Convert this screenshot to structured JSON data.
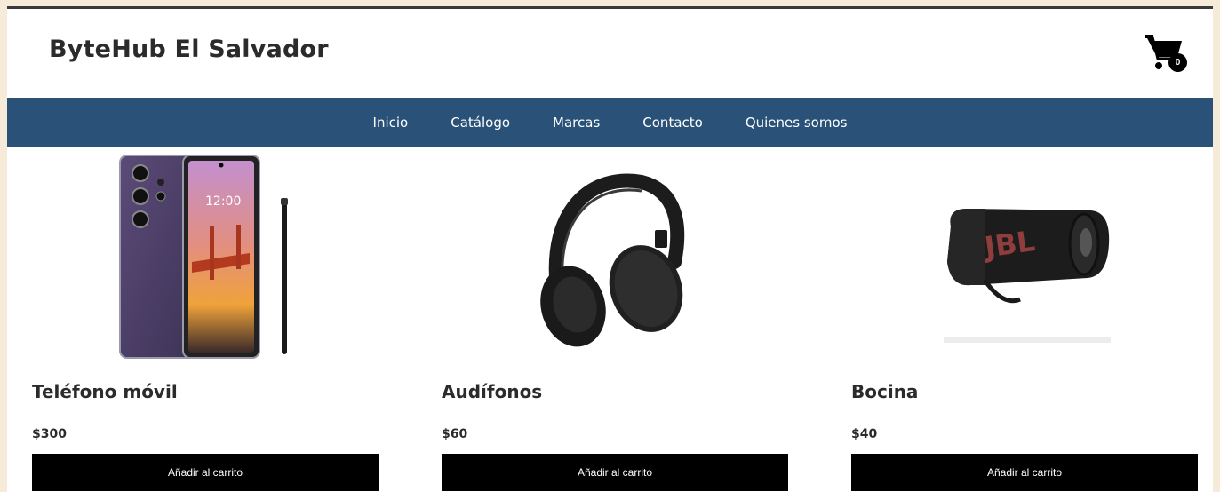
{
  "header": {
    "brand": "ByteHub El Salvador",
    "cart_count": "0",
    "cart_icon": "shopping-cart-icon"
  },
  "nav": {
    "items": [
      {
        "label": "Inicio"
      },
      {
        "label": "Catálogo"
      },
      {
        "label": "Marcas"
      },
      {
        "label": "Contacto"
      },
      {
        "label": "Quienes somos"
      }
    ]
  },
  "products": [
    {
      "name": "Teléfono móvil",
      "price": "$300",
      "button": "Añadir al carrito",
      "image": "smartphone-with-stylus-image"
    },
    {
      "name": "Audífonos",
      "price": "$60",
      "button": "Añadir al carrito",
      "image": "headphones-image"
    },
    {
      "name": "Bocina",
      "price": "$40",
      "button": "Añadir al carrito",
      "image": "speaker-image"
    }
  ],
  "colors": {
    "background": "#f6ead9",
    "navbar": "#2a5177",
    "button": "#000000"
  }
}
